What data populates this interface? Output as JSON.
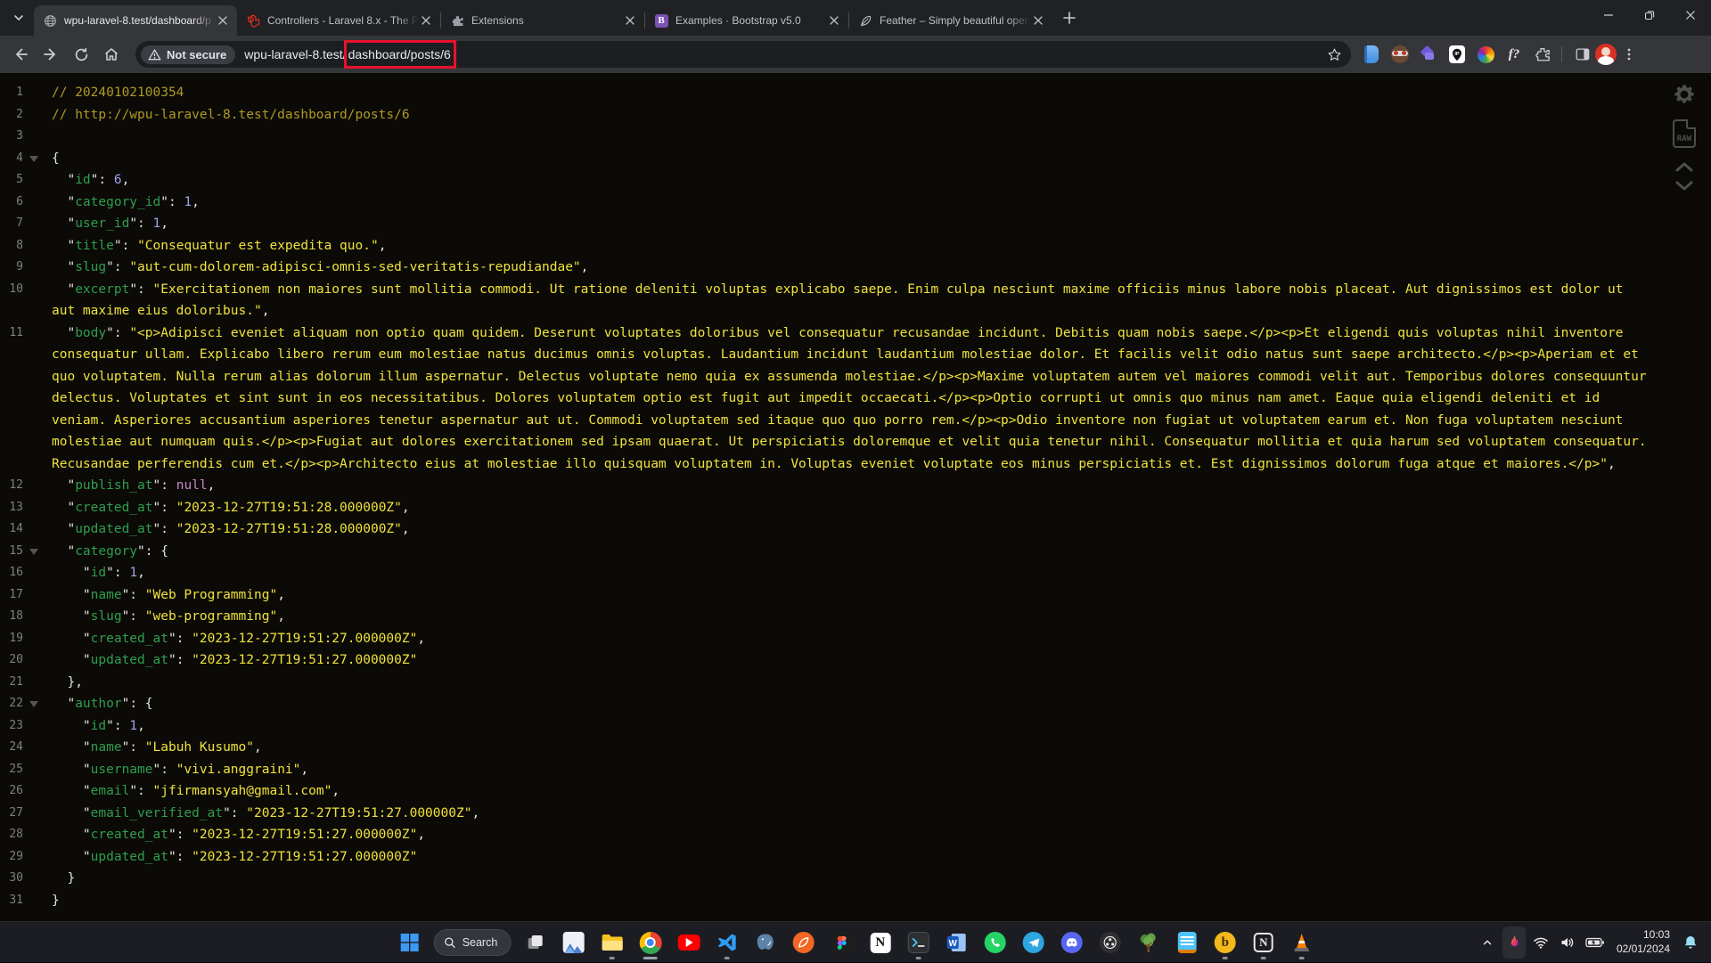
{
  "browser": {
    "tabs": [
      {
        "id": "wpu-laravel",
        "icon": "globe",
        "title": "wpu-laravel-8.test/dashboard/p",
        "active": true
      },
      {
        "id": "laravel-docs",
        "icon": "laravel",
        "title": "Controllers - Laravel 8.x - The P",
        "active": false
      },
      {
        "id": "extensions",
        "icon": "puzzle",
        "title": "Extensions",
        "active": false
      },
      {
        "id": "bootstrap",
        "icon": "bootstrap",
        "title": "Examples · Bootstrap v5.0",
        "active": false
      },
      {
        "id": "feather",
        "icon": "feather",
        "title": "Feather – Simply beautiful open",
        "active": false
      }
    ],
    "window_controls": [
      "minimize",
      "restore",
      "close"
    ],
    "toolbar": {
      "security_chip": "Not secure",
      "url_domain": "wpu-laravel-8.test/",
      "url_path": "dashboard/posts/6",
      "highlight_color": "#e8112d",
      "extensions": [
        "notebook-ext",
        "goggles-ext",
        "purple-ext",
        "ip-pin-ext",
        "color-wheel-ext",
        "font-finder-ext",
        "puzzle-ext"
      ],
      "right_icons": [
        "sidebar-icon",
        "profile-avatar",
        "kebab-menu-icon"
      ]
    }
  },
  "viewer": {
    "raw_label": "RAW",
    "side_buttons": [
      "settings-gear",
      "raw-document",
      "scroll-up",
      "scroll-down"
    ]
  },
  "code": {
    "comment_color": "#b09a24",
    "key_color": "#2f9e4f",
    "string_color": "#f0e23c",
    "number_color": "#9fa4ee",
    "null_color": "#c586c0",
    "background": "#0b0a06",
    "lines": [
      {
        "n": 1,
        "a": false,
        "seg": [
          [
            "cm",
            "// 20240102100354"
          ]
        ]
      },
      {
        "n": 2,
        "a": false,
        "seg": [
          [
            "cm",
            "// http://wpu-laravel-8.test/dashboard/posts/6"
          ]
        ]
      },
      {
        "n": 3,
        "a": false,
        "seg": []
      },
      {
        "n": 4,
        "a": true,
        "seg": [
          [
            "p",
            "{"
          ]
        ]
      },
      {
        "n": 5,
        "a": false,
        "seg": [
          [
            "p",
            "  \""
          ],
          [
            "k",
            "id"
          ],
          [
            "p",
            "\": "
          ],
          [
            "n",
            "6"
          ],
          [
            "p",
            ","
          ]
        ]
      },
      {
        "n": 6,
        "a": false,
        "seg": [
          [
            "p",
            "  \""
          ],
          [
            "k",
            "category_id"
          ],
          [
            "p",
            "\": "
          ],
          [
            "n",
            "1"
          ],
          [
            "p",
            ","
          ]
        ]
      },
      {
        "n": 7,
        "a": false,
        "seg": [
          [
            "p",
            "  \""
          ],
          [
            "k",
            "user_id"
          ],
          [
            "p",
            "\": "
          ],
          [
            "n",
            "1"
          ],
          [
            "p",
            ","
          ]
        ]
      },
      {
        "n": 8,
        "a": false,
        "seg": [
          [
            "p",
            "  \""
          ],
          [
            "k",
            "title"
          ],
          [
            "p",
            "\": "
          ],
          [
            "s",
            "\"Consequatur est expedita quo.\""
          ],
          [
            "p",
            ","
          ]
        ]
      },
      {
        "n": 9,
        "a": false,
        "seg": [
          [
            "p",
            "  \""
          ],
          [
            "k",
            "slug"
          ],
          [
            "p",
            "\": "
          ],
          [
            "s",
            "\"aut-cum-dolorem-adipisci-omnis-sed-veritatis-repudiandae\""
          ],
          [
            "p",
            ","
          ]
        ]
      },
      {
        "n": 10,
        "a": false,
        "seg": [
          [
            "p",
            "  \""
          ],
          [
            "k",
            "excerpt"
          ],
          [
            "p",
            "\": "
          ],
          [
            "s",
            "\"Exercitationem non maiores sunt mollitia commodi. Ut ratione deleniti voluptas explicabo saepe. Enim culpa nesciunt maxime officiis minus labore nobis placeat. Aut dignissimos est dolor ut aut maxime eius doloribus.\""
          ],
          [
            "p",
            ","
          ]
        ]
      },
      {
        "n": 11,
        "a": false,
        "seg": [
          [
            "p",
            "  \""
          ],
          [
            "k",
            "body"
          ],
          [
            "p",
            "\": "
          ],
          [
            "s",
            "\"<p>Adipisci eveniet aliquam non optio quam quidem. Deserunt voluptates doloribus vel consequatur recusandae incidunt. Debitis quam nobis saepe.</p><p>Et eligendi quis voluptas nihil inventore consequatur ullam. Explicabo libero rerum eum molestiae natus ducimus omnis voluptas. Laudantium incidunt laudantium molestiae dolor. Et facilis velit odio natus sunt saepe architecto.</p><p>Aperiam et et quo voluptatem. Nulla rerum alias dolorum illum aspernatur. Delectus voluptate nemo quia ex assumenda molestiae.</p><p>Maxime voluptatem autem vel maiores commodi velit aut. Temporibus dolores consequuntur delectus. Voluptates et sint sunt in eos necessitatibus. Dolores voluptatem optio est fugit aut impedit occaecati.</p><p>Optio corrupti ut omnis quo minus nam amet. Eaque quia eligendi deleniti et id veniam. Asperiores accusantium asperiores tenetur aspernatur aut ut. Commodi voluptatem sed itaque quo quo porro rem.</p><p>Odio inventore non fugiat ut voluptatem earum et. Non fuga voluptatem nesciunt molestiae aut numquam quis.</p><p>Fugiat aut dolores exercitationem sed ipsam quaerat. Ut perspiciatis doloremque et velit quia tenetur nihil. Consequatur mollitia et quia harum sed voluptatem consequatur. Recusandae perferendis cum et.</p><p>Architecto eius at molestiae illo quisquam voluptatem in. Voluptas eveniet voluptate eos minus perspiciatis et. Est dignissimos dolorum fuga atque et maiores.</p>\""
          ],
          [
            "p",
            ","
          ]
        ]
      },
      {
        "n": 12,
        "a": false,
        "seg": [
          [
            "p",
            "  \""
          ],
          [
            "k",
            "publish_at"
          ],
          [
            "p",
            "\": "
          ],
          [
            "u",
            "null"
          ],
          [
            "p",
            ","
          ]
        ]
      },
      {
        "n": 13,
        "a": false,
        "seg": [
          [
            "p",
            "  \""
          ],
          [
            "k",
            "created_at"
          ],
          [
            "p",
            "\": "
          ],
          [
            "s",
            "\"2023-12-27T19:51:28.000000Z\""
          ],
          [
            "p",
            ","
          ]
        ]
      },
      {
        "n": 14,
        "a": false,
        "seg": [
          [
            "p",
            "  \""
          ],
          [
            "k",
            "updated_at"
          ],
          [
            "p",
            "\": "
          ],
          [
            "s",
            "\"2023-12-27T19:51:28.000000Z\""
          ],
          [
            "p",
            ","
          ]
        ]
      },
      {
        "n": 15,
        "a": true,
        "seg": [
          [
            "p",
            "  \""
          ],
          [
            "k",
            "category"
          ],
          [
            "p",
            "\": {"
          ]
        ]
      },
      {
        "n": 16,
        "a": false,
        "seg": [
          [
            "p",
            "    \""
          ],
          [
            "k",
            "id"
          ],
          [
            "p",
            "\": "
          ],
          [
            "n",
            "1"
          ],
          [
            "p",
            ","
          ]
        ]
      },
      {
        "n": 17,
        "a": false,
        "seg": [
          [
            "p",
            "    \""
          ],
          [
            "k",
            "name"
          ],
          [
            "p",
            "\": "
          ],
          [
            "s",
            "\"Web Programming\""
          ],
          [
            "p",
            ","
          ]
        ]
      },
      {
        "n": 18,
        "a": false,
        "seg": [
          [
            "p",
            "    \""
          ],
          [
            "k",
            "slug"
          ],
          [
            "p",
            "\": "
          ],
          [
            "s",
            "\"web-programming\""
          ],
          [
            "p",
            ","
          ]
        ]
      },
      {
        "n": 19,
        "a": false,
        "seg": [
          [
            "p",
            "    \""
          ],
          [
            "k",
            "created_at"
          ],
          [
            "p",
            "\": "
          ],
          [
            "s",
            "\"2023-12-27T19:51:27.000000Z\""
          ],
          [
            "p",
            ","
          ]
        ]
      },
      {
        "n": 20,
        "a": false,
        "seg": [
          [
            "p",
            "    \""
          ],
          [
            "k",
            "updated_at"
          ],
          [
            "p",
            "\": "
          ],
          [
            "s",
            "\"2023-12-27T19:51:27.000000Z\""
          ]
        ]
      },
      {
        "n": 21,
        "a": false,
        "seg": [
          [
            "p",
            "  },"
          ]
        ]
      },
      {
        "n": 22,
        "a": true,
        "seg": [
          [
            "p",
            "  \""
          ],
          [
            "k",
            "author"
          ],
          [
            "p",
            "\": {"
          ]
        ]
      },
      {
        "n": 23,
        "a": false,
        "seg": [
          [
            "p",
            "    \""
          ],
          [
            "k",
            "id"
          ],
          [
            "p",
            "\": "
          ],
          [
            "n",
            "1"
          ],
          [
            "p",
            ","
          ]
        ]
      },
      {
        "n": 24,
        "a": false,
        "seg": [
          [
            "p",
            "    \""
          ],
          [
            "k",
            "name"
          ],
          [
            "p",
            "\": "
          ],
          [
            "s",
            "\"Labuh Kusumo\""
          ],
          [
            "p",
            ","
          ]
        ]
      },
      {
        "n": 25,
        "a": false,
        "seg": [
          [
            "p",
            "    \""
          ],
          [
            "k",
            "username"
          ],
          [
            "p",
            "\": "
          ],
          [
            "s",
            "\"vivi.anggraini\""
          ],
          [
            "p",
            ","
          ]
        ]
      },
      {
        "n": 26,
        "a": false,
        "seg": [
          [
            "p",
            "    \""
          ],
          [
            "k",
            "email"
          ],
          [
            "p",
            "\": "
          ],
          [
            "s",
            "\"jfirmansyah@gmail.com\""
          ],
          [
            "p",
            ","
          ]
        ]
      },
      {
        "n": 27,
        "a": false,
        "seg": [
          [
            "p",
            "    \""
          ],
          [
            "k",
            "email_verified_at"
          ],
          [
            "p",
            "\": "
          ],
          [
            "s",
            "\"2023-12-27T19:51:27.000000Z\""
          ],
          [
            "p",
            ","
          ]
        ]
      },
      {
        "n": 28,
        "a": false,
        "seg": [
          [
            "p",
            "    \""
          ],
          [
            "k",
            "created_at"
          ],
          [
            "p",
            "\": "
          ],
          [
            "s",
            "\"2023-12-27T19:51:27.000000Z\""
          ],
          [
            "p",
            ","
          ]
        ]
      },
      {
        "n": 29,
        "a": false,
        "seg": [
          [
            "p",
            "    \""
          ],
          [
            "k",
            "updated_at"
          ],
          [
            "p",
            "\": "
          ],
          [
            "s",
            "\"2023-12-27T19:51:27.000000Z\""
          ]
        ]
      },
      {
        "n": 30,
        "a": false,
        "seg": [
          [
            "p",
            "  }"
          ]
        ]
      },
      {
        "n": 31,
        "a": false,
        "seg": [
          [
            "p",
            "}"
          ]
        ]
      }
    ]
  },
  "taskbar": {
    "search_label": "Search",
    "apps": [
      {
        "id": "start",
        "dot": "none"
      },
      {
        "id": "search",
        "dot": "none"
      },
      {
        "id": "taskview",
        "dot": "none"
      },
      {
        "id": "photos",
        "dot": "none"
      },
      {
        "id": "explorer",
        "dot": "run"
      },
      {
        "id": "chrome",
        "dot": "active"
      },
      {
        "id": "youtube",
        "dot": "none"
      },
      {
        "id": "vscode",
        "dot": "run"
      },
      {
        "id": "postgresql",
        "dot": "none"
      },
      {
        "id": "laragon",
        "dot": "none"
      },
      {
        "id": "figma",
        "dot": "none"
      },
      {
        "id": "notion",
        "dot": "none"
      },
      {
        "id": "terminal",
        "dot": "run"
      },
      {
        "id": "word",
        "dot": "none"
      },
      {
        "id": "whatsapp",
        "dot": "none"
      },
      {
        "id": "telegram",
        "dot": "none"
      },
      {
        "id": "discord",
        "dot": "none"
      },
      {
        "id": "obs",
        "dot": "none"
      },
      {
        "id": "tree-app",
        "dot": "none"
      },
      {
        "id": "notepad",
        "dot": "none"
      },
      {
        "id": "bruno",
        "dot": "run"
      },
      {
        "id": "notion-alt",
        "dot": "run"
      },
      {
        "id": "vlc",
        "dot": "run"
      }
    ],
    "tray": {
      "icons": [
        "chevron-up",
        "flame",
        "wifi",
        "volume",
        "battery-charging",
        "bell"
      ],
      "time": "10:03",
      "date": "02/01/2024",
      "bell_color": "#9adcf0"
    }
  }
}
